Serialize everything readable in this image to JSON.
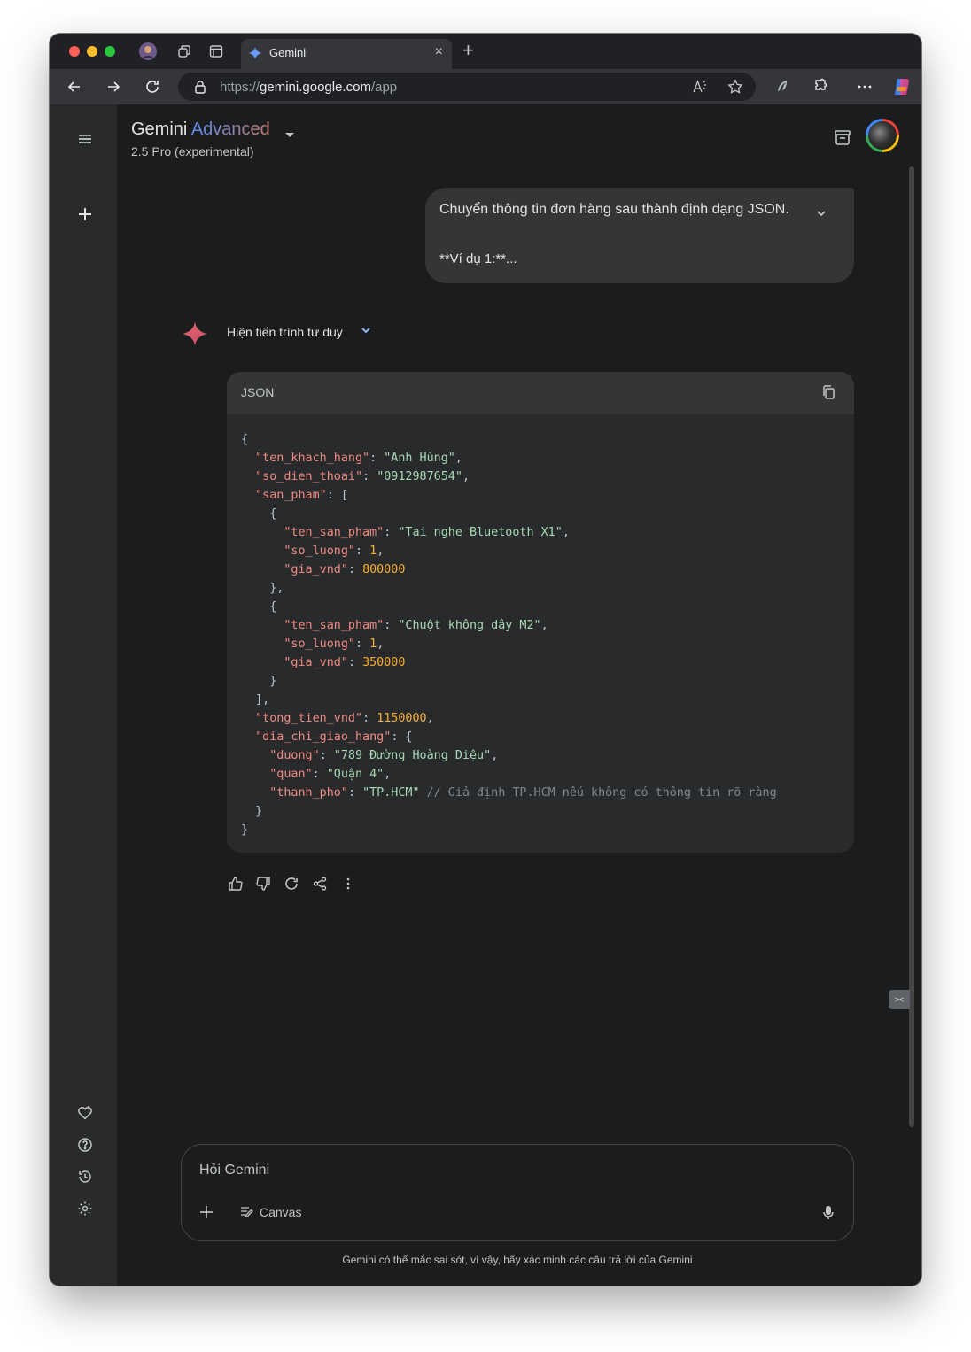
{
  "browser": {
    "tab_title": "Gemini",
    "url_prefix": "https://",
    "url_domain": "gemini.google.com",
    "url_path": "/app",
    "tab_close": "×",
    "new_tab": "+"
  },
  "header": {
    "brand": "Gemini",
    "tier": "Advanced",
    "model": "2.5 Pro (experimental)"
  },
  "user_message": {
    "line1": "Chuyển thông tin đơn hàng sau thành định dạng JSON.",
    "line2": "**Ví dụ 1:**..."
  },
  "response": {
    "thinking_label": "Hiện tiến trình tư duy",
    "code_language": "JSON"
  },
  "code_json": {
    "ten_khach_hang": "Anh Hùng",
    "so_dien_thoai": "0912987654",
    "san_pham": [
      {
        "ten_san_pham": "Tai nghe Bluetooth X1",
        "so_luong": 1,
        "gia_vnd": 800000
      },
      {
        "ten_san_pham": "Chuột không dây M2",
        "so_luong": 1,
        "gia_vnd": 350000
      }
    ],
    "tong_tien_vnd": 1150000,
    "dia_chi_giao_hang": {
      "duong": "789 Đường Hoàng Diệu",
      "quan": "Quận 4",
      "thanh_pho": "TP.HCM",
      "thanh_pho_comment": "// Giả định TP.HCM nếu không có thông tin rõ ràng"
    }
  },
  "composer": {
    "placeholder": "Hỏi Gemini",
    "canvas_label": "Canvas"
  },
  "footer": {
    "disclaimer": "Gemini có thể mắc sai sót, vì vậy, hãy xác minh các câu trả lời của Gemini"
  },
  "colors": {
    "accent_blue": "#5b8def",
    "spark_red": "#e06a6a",
    "window_bg": "#1b1c1d",
    "json_key": "#f28b82",
    "json_string": "#a8dab5",
    "json_number": "#f6ae2d"
  },
  "icons": {
    "rail": [
      "menu-icon",
      "new-chat-icon",
      "gem-icon",
      "help-icon",
      "activity-icon",
      "settings-icon"
    ],
    "actions": [
      "thumb-up-icon",
      "thumb-down-icon",
      "regenerate-icon",
      "share-icon",
      "more-vert-icon"
    ]
  }
}
